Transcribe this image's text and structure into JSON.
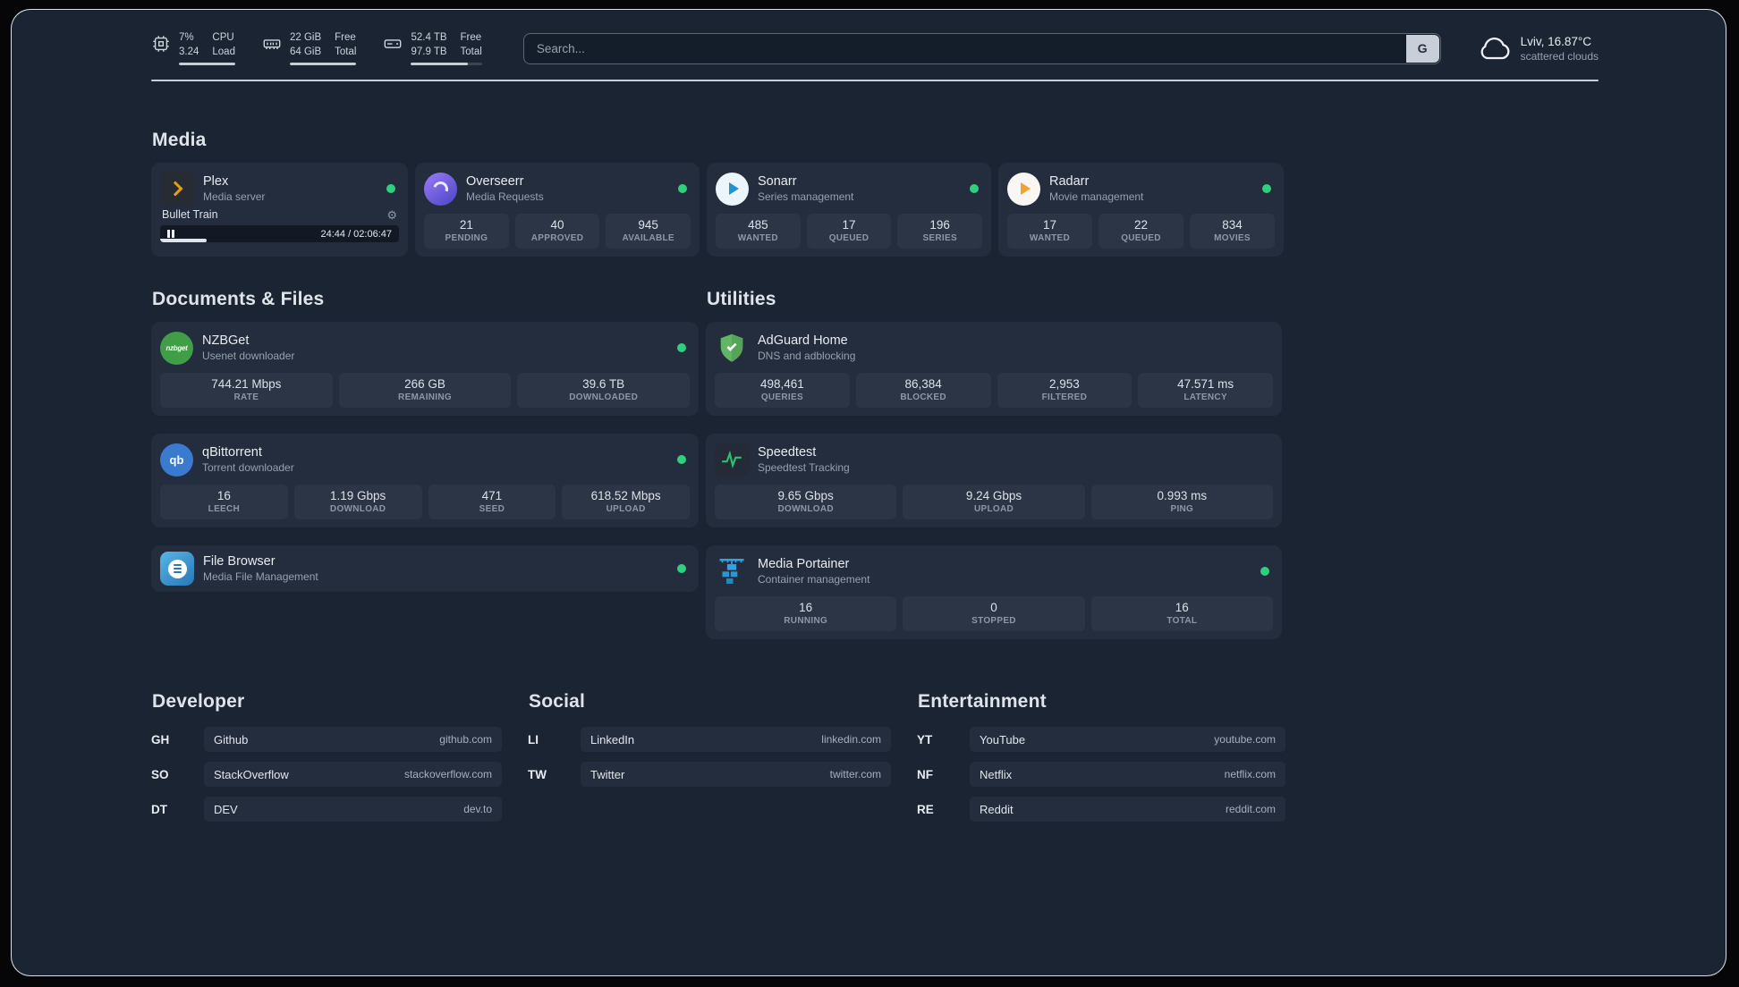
{
  "theme": {
    "panel_bg": "#1b2433",
    "card_bg": "#232d3d",
    "stat_bg": "#2b3546",
    "status_online": "#2fd07d",
    "accent_text": "#e9ecf1",
    "muted_text": "#96a0ae"
  },
  "topbar": {
    "resources": [
      {
        "name": "cpu",
        "col1_top": "7%",
        "col1_bottom": "3.24",
        "col2_top": "CPU",
        "col2_bottom": "Load"
      },
      {
        "name": "ram",
        "col1_top": "22 GiB",
        "col1_bottom": "64 GiB",
        "col2_top": "Free",
        "col2_bottom": "Total"
      },
      {
        "name": "disk",
        "col1_top": "52.4 TB",
        "col1_bottom": "97.9 TB",
        "col2_top": "Free",
        "col2_bottom": "Total"
      }
    ],
    "search": {
      "placeholder": "Search...",
      "provider_label": "G"
    },
    "weather": {
      "location": "Lviv, 16.87°C",
      "condition": "scattered clouds"
    }
  },
  "sections": {
    "media": {
      "title": "Media",
      "plex": {
        "name": "Plex",
        "subtitle": "Media server",
        "track": "Bullet Train",
        "time": "24:44 / 02:06:47",
        "progress_pct": 19.5
      },
      "overseerr": {
        "name": "Overseerr",
        "subtitle": "Media Requests",
        "stats": [
          {
            "value": "21",
            "label": "PENDING"
          },
          {
            "value": "40",
            "label": "APPROVED"
          },
          {
            "value": "945",
            "label": "AVAILABLE"
          }
        ]
      },
      "sonarr": {
        "name": "Sonarr",
        "subtitle": "Series management",
        "stats": [
          {
            "value": "485",
            "label": "WANTED"
          },
          {
            "value": "17",
            "label": "QUEUED"
          },
          {
            "value": "196",
            "label": "SERIES"
          }
        ]
      },
      "radarr": {
        "name": "Radarr",
        "subtitle": "Movie management",
        "stats": [
          {
            "value": "17",
            "label": "WANTED"
          },
          {
            "value": "22",
            "label": "QUEUED"
          },
          {
            "value": "834",
            "label": "MOVIES"
          }
        ]
      }
    },
    "documents": {
      "title": "Documents & Files",
      "nzbget": {
        "name": "NZBGet",
        "subtitle": "Usenet downloader",
        "stats": [
          {
            "value": "744.21 Mbps",
            "label": "RATE"
          },
          {
            "value": "266 GB",
            "label": "REMAINING"
          },
          {
            "value": "39.6 TB",
            "label": "DOWNLOADED"
          }
        ]
      },
      "qbittorrent": {
        "name": "qBittorrent",
        "subtitle": "Torrent downloader",
        "stats": [
          {
            "value": "16",
            "label": "LEECH"
          },
          {
            "value": "1.19 Gbps",
            "label": "DOWNLOAD"
          },
          {
            "value": "471",
            "label": "SEED"
          },
          {
            "value": "618.52 Mbps",
            "label": "UPLOAD"
          }
        ]
      },
      "filebrowser": {
        "name": "File Browser",
        "subtitle": "Media File Management"
      }
    },
    "utilities": {
      "title": "Utilities",
      "adguard": {
        "name": "AdGuard Home",
        "subtitle": "DNS and adblocking",
        "stats": [
          {
            "value": "498,461",
            "label": "QUERIES"
          },
          {
            "value": "86,384",
            "label": "BLOCKED"
          },
          {
            "value": "2,953",
            "label": "FILTERED"
          },
          {
            "value": "47.571 ms",
            "label": "LATENCY"
          }
        ]
      },
      "speedtest": {
        "name": "Speedtest",
        "subtitle": "Speedtest Tracking",
        "stats": [
          {
            "value": "9.65 Gbps",
            "label": "DOWNLOAD"
          },
          {
            "value": "9.24 Gbps",
            "label": "UPLOAD"
          },
          {
            "value": "0.993 ms",
            "label": "PING"
          }
        ]
      },
      "portainer": {
        "name": "Media Portainer",
        "subtitle": "Container management",
        "stats": [
          {
            "value": "16",
            "label": "RUNNING"
          },
          {
            "value": "0",
            "label": "STOPPED"
          },
          {
            "value": "16",
            "label": "TOTAL"
          }
        ]
      }
    },
    "bookmarks": {
      "developer": {
        "title": "Developer",
        "links": [
          {
            "abbr": "GH",
            "name": "Github",
            "domain": "github.com"
          },
          {
            "abbr": "SO",
            "name": "StackOverflow",
            "domain": "stackoverflow.com"
          },
          {
            "abbr": "DT",
            "name": "DEV",
            "domain": "dev.to"
          }
        ]
      },
      "social": {
        "title": "Social",
        "links": [
          {
            "abbr": "LI",
            "name": "LinkedIn",
            "domain": "linkedin.com"
          },
          {
            "abbr": "TW",
            "name": "Twitter",
            "domain": "twitter.com"
          }
        ]
      },
      "entertainment": {
        "title": "Entertainment",
        "links": [
          {
            "abbr": "YT",
            "name": "YouTube",
            "domain": "youtube.com"
          },
          {
            "abbr": "NF",
            "name": "Netflix",
            "domain": "netflix.com"
          },
          {
            "abbr": "RE",
            "name": "Reddit",
            "domain": "reddit.com"
          }
        ]
      }
    }
  }
}
